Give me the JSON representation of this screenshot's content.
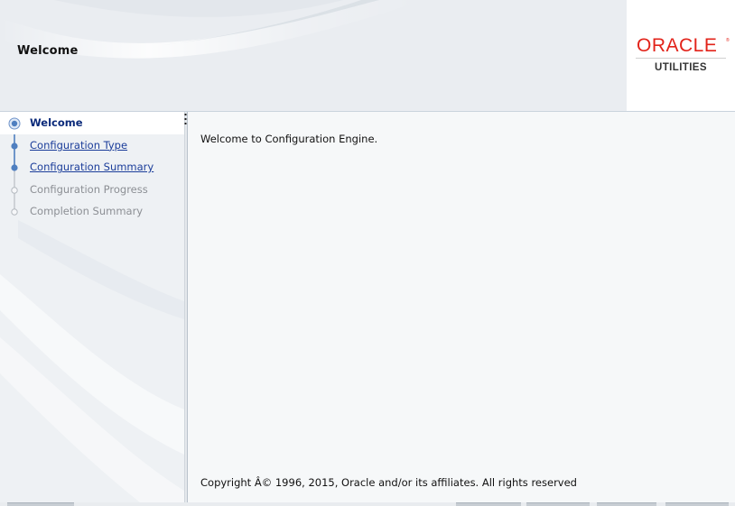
{
  "header": {
    "title": "Welcome",
    "logo_brand": "ORACLE",
    "logo_sub": "UTILITIES"
  },
  "nav": {
    "items": [
      {
        "label": "Welcome",
        "state": "current"
      },
      {
        "label": "Configuration Type",
        "state": "link"
      },
      {
        "label": "Configuration Summary",
        "state": "link"
      },
      {
        "label": "Configuration Progress",
        "state": "pending"
      },
      {
        "label": "Completion Summary",
        "state": "pending"
      }
    ]
  },
  "main": {
    "welcome_text": "Welcome to Configuration Engine.",
    "copyright": "Copyright Â© 1996, 2015, Oracle and/or its affiliates. All rights reserved"
  },
  "colors": {
    "oracle_red": "#e2231a",
    "active_nav_text": "#0b2a7a",
    "link_text": "#1b3d9a",
    "pending_text": "#8c8f94",
    "step_node": "#4f7fc0"
  },
  "icons": {
    "current_step": "step-current-icon",
    "done_step": "step-done-icon",
    "pending_step": "step-pending-icon"
  }
}
